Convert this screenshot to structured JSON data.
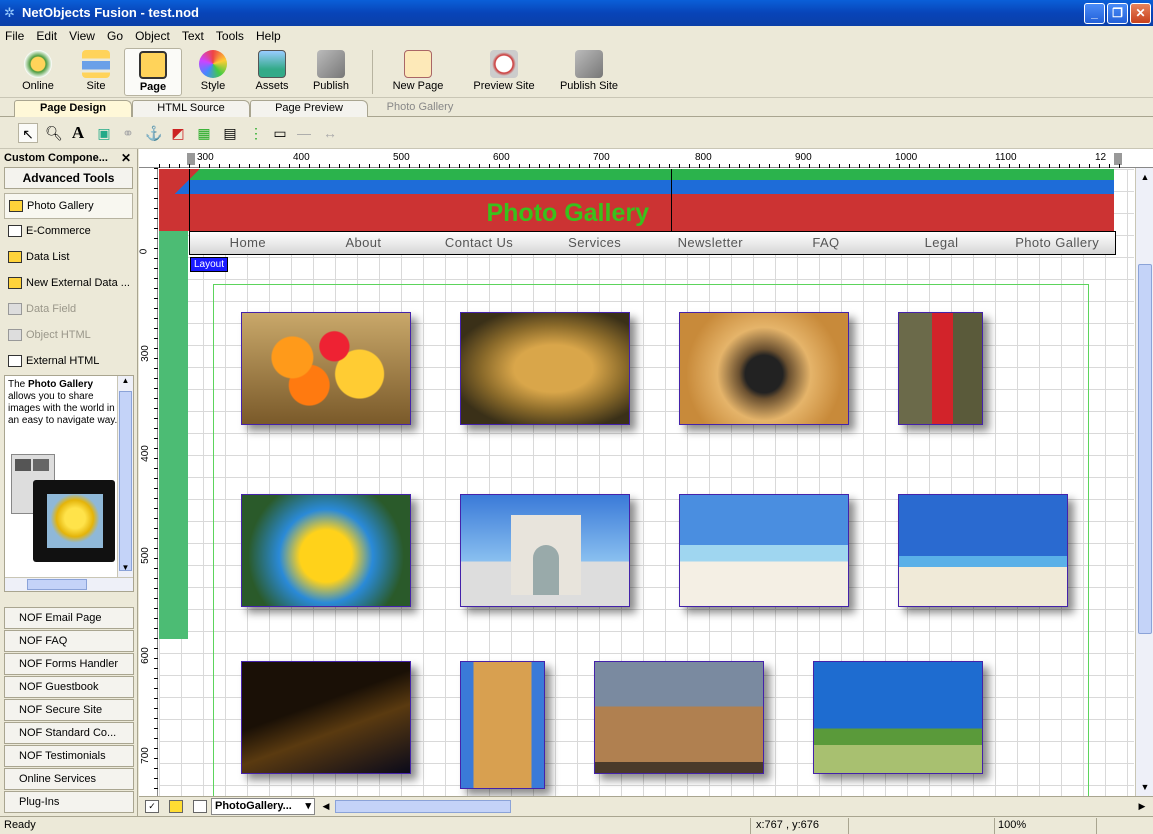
{
  "window": {
    "title": "NetObjects Fusion - test.nod"
  },
  "menu": [
    "File",
    "Edit",
    "View",
    "Go",
    "Object",
    "Text",
    "Tools",
    "Help"
  ],
  "main_toolbar": {
    "buttons": [
      "Online",
      "Site",
      "Page",
      "Style",
      "Assets",
      "Publish",
      "New Page",
      "Preview Site",
      "Publish Site"
    ]
  },
  "tabs": [
    "Page Design",
    "HTML Source",
    "Page Preview",
    "Photo Gallery"
  ],
  "left_panel": {
    "header": "Custom Compone...",
    "section": "Advanced Tools",
    "items": [
      "Photo Gallery",
      "E-Commerce",
      "Data List",
      "New External Data ...",
      "Data Field",
      "Object HTML",
      "External HTML"
    ],
    "desc_pre": "The ",
    "desc_bold": "Photo Gallery",
    "desc_post": " allows you to share images with the world in an easy to navigate way.",
    "bottom_items": [
      "NOF Email Page",
      "NOF FAQ",
      "NOF Forms Handler",
      "NOF Guestbook",
      "NOF Secure Site",
      "NOF Standard Co...",
      "NOF Testimonials",
      "Online Services",
      "Plug-Ins"
    ]
  },
  "ruler": {
    "h_ticks": [
      "300",
      "400",
      "500",
      "600",
      "700",
      "800",
      "900",
      "1000",
      "1100",
      "12"
    ],
    "v_ticks": [
      "0",
      "300",
      "400",
      "500",
      "600",
      "700"
    ]
  },
  "page": {
    "banner_title": "Photo Gallery",
    "nav": [
      "Home",
      "About",
      "Contact Us",
      "Services",
      "Newsletter",
      "FAQ",
      "Legal",
      "Photo Gallery"
    ],
    "layout_label": "Layout"
  },
  "gallery": {
    "photos": [
      "fruit",
      "leopard",
      "monkey",
      "parrot-red",
      "parrot-blue",
      "arc-de-triomphe",
      "beach-palm",
      "beach-umbrella",
      "bridge-night",
      "cathedral",
      "colosseum",
      "meadow-sky"
    ]
  },
  "bottom_bar": {
    "page_select": "PhotoGallery..."
  },
  "status": {
    "left": "Ready",
    "coords": "x:767 , y:676",
    "zoom": "100%"
  },
  "colors": {
    "accent": "#0a5fd8",
    "banner_green": "#39c11c",
    "banner_red": "#cc3333",
    "layout_blue": "#1a1aff"
  }
}
